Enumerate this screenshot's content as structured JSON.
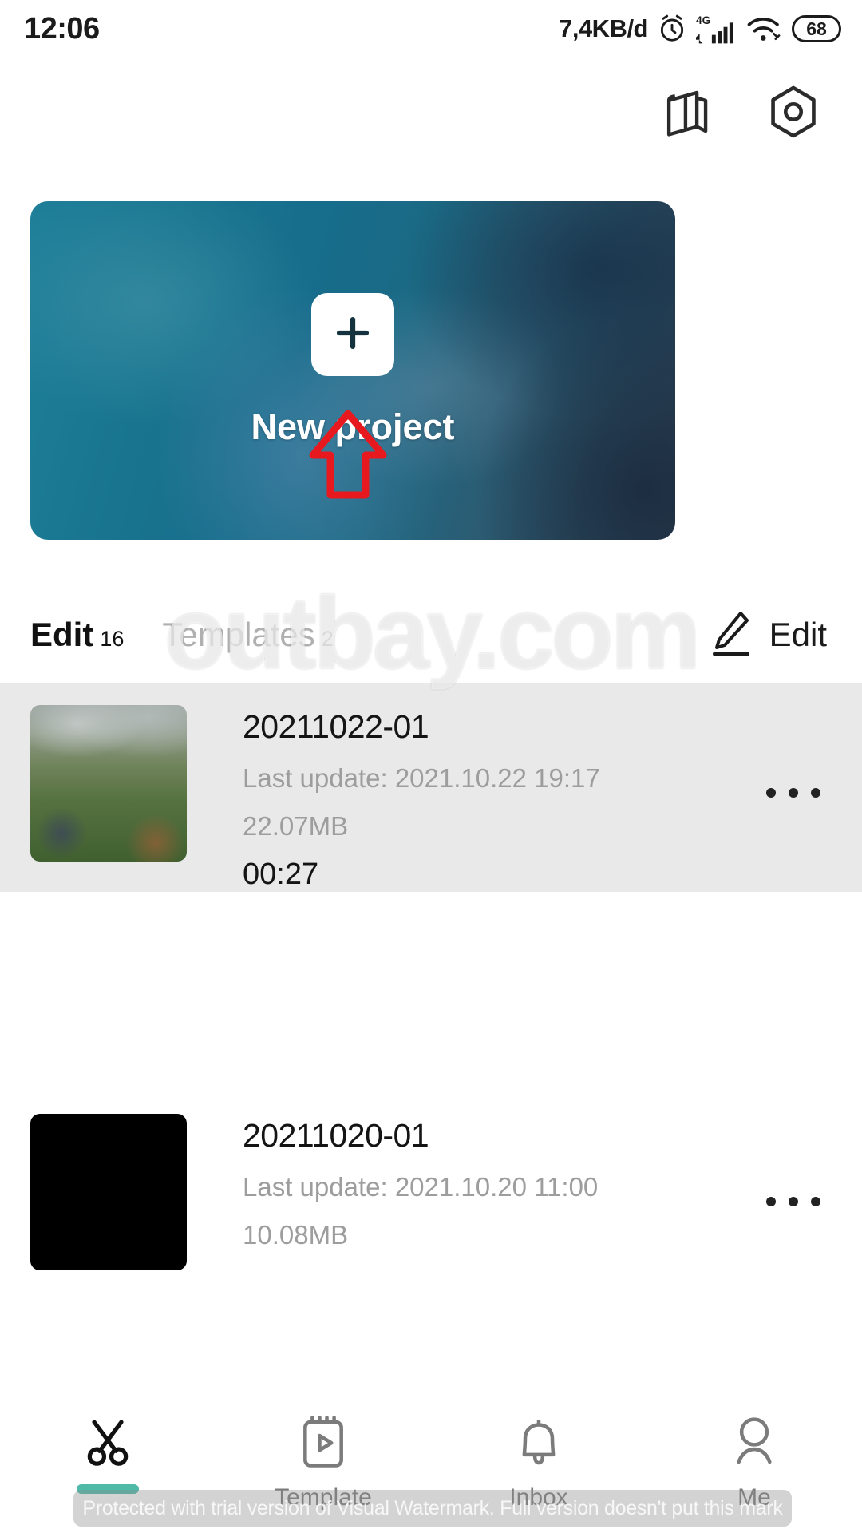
{
  "status_bar": {
    "time": "12:06",
    "network_speed": "7,4KB/d",
    "alarm_icon": "alarm-clock-icon",
    "signal_label": "4G",
    "wifi_icon": "wifi-icon",
    "battery_level": "68"
  },
  "header": {
    "tutorial_icon": "book-icon",
    "settings_icon": "hexagon-settings-icon"
  },
  "banner": {
    "plus_icon": "plus-icon",
    "label": "New project"
  },
  "annotation": {
    "arrow_icon": "up-arrow-annotation",
    "color": "#e8191e"
  },
  "tabs": {
    "items": [
      {
        "label": "Edit",
        "count": "16",
        "active": true
      },
      {
        "label": "Templates",
        "count": "2",
        "active": false
      }
    ],
    "edit_action": {
      "icon": "pencil-icon",
      "label": "Edit"
    }
  },
  "projects": [
    {
      "title": "20211022-01",
      "last_update": "Last update: 2021.10.22 19:17",
      "size": "22.07MB",
      "duration": "00:27",
      "more_icon": "more-options-icon",
      "selected": true
    },
    {
      "title": "20211020-01",
      "last_update": "Last update: 2021.10.20 11:00",
      "size": "10.08MB",
      "duration": "",
      "more_icon": "more-options-icon",
      "selected": false
    }
  ],
  "watermarks": {
    "center_text": "outbay.com",
    "bottom_text": "Protected with trial version of Visual Watermark. Full version doesn't put this mark"
  },
  "bottom_nav": {
    "accent_color": "#4fbaa8",
    "items": [
      {
        "icon": "scissors-icon",
        "label": "",
        "active": true
      },
      {
        "icon": "template-icon",
        "label": "Template",
        "active": false
      },
      {
        "icon": "bell-icon",
        "label": "Inbox",
        "active": false
      },
      {
        "icon": "person-icon",
        "label": "Me",
        "active": false
      }
    ]
  }
}
